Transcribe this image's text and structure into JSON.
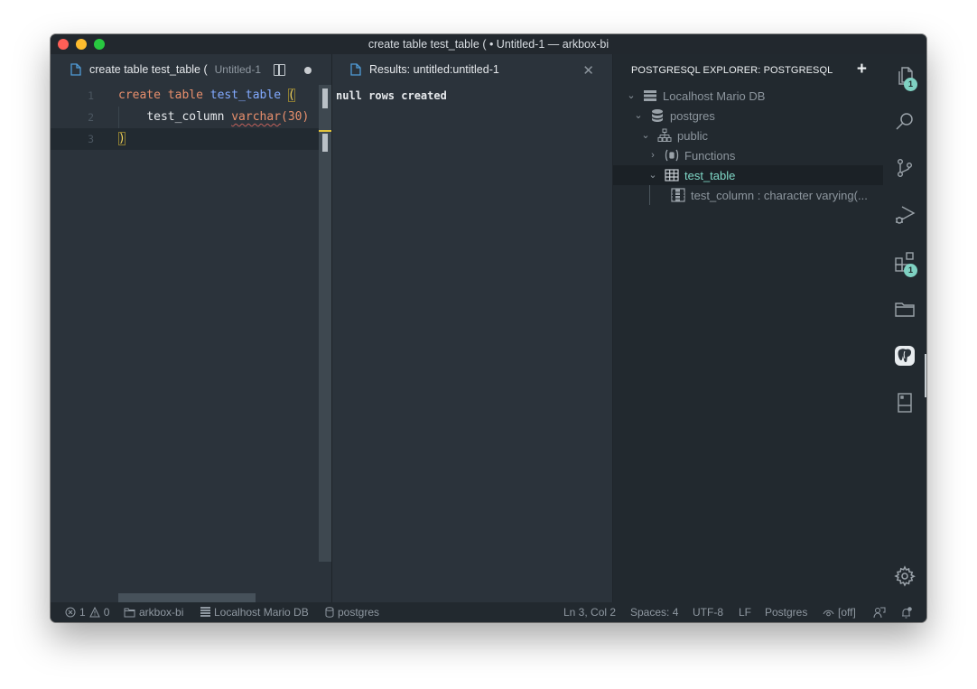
{
  "window": {
    "title": "create table test_table ( • Untitled-1 — arkbox-bi"
  },
  "editor": {
    "tab": {
      "title": "create table test_table (",
      "description": "Untitled-1"
    },
    "lines": [
      {
        "number": "1",
        "tokens": [
          [
            "kw",
            "create"
          ],
          [
            "sp",
            " "
          ],
          [
            "kw",
            "table"
          ],
          [
            "sp",
            " "
          ],
          [
            "ident",
            "test_table"
          ],
          [
            "sp",
            " "
          ],
          [
            "paren",
            "("
          ]
        ]
      },
      {
        "number": "2",
        "tokens": [
          [
            "sp",
            "    test_column "
          ],
          [
            "type",
            "varchar"
          ],
          [
            "num",
            "(30)"
          ]
        ]
      },
      {
        "number": "3",
        "tokens": [
          [
            "paren",
            ")"
          ]
        ]
      }
    ],
    "code_line1_kw1": "create",
    "code_line1_kw2": "table",
    "code_line1_ident": "test_table",
    "code_line1_paren": "(",
    "code_line2_col": "test_column",
    "code_line2_type": "varchar",
    "code_line2_args": "(30)",
    "code_line3_paren": ")"
  },
  "results": {
    "tab_title": "Results: untitled:untitled-1",
    "output": "null rows created"
  },
  "explorer": {
    "title": "POSTGRESQL EXPLORER: POSTGRESQL",
    "tree": [
      {
        "label": "Localhost Mario DB",
        "icon": "server-icon",
        "expanded": true
      },
      {
        "label": "postgres",
        "icon": "database-icon",
        "expanded": true
      },
      {
        "label": "public",
        "icon": "schema-icon",
        "expanded": true
      },
      {
        "label": "Functions",
        "icon": "function-icon",
        "expanded": false
      },
      {
        "label": "test_table",
        "icon": "table-icon",
        "expanded": true,
        "selected": true
      },
      {
        "label": "test_column : character varying(...",
        "icon": "column-icon"
      }
    ]
  },
  "activity_bar": {
    "items": [
      {
        "name": "explorer",
        "badge": "1"
      },
      {
        "name": "search"
      },
      {
        "name": "source-control"
      },
      {
        "name": "run-debug"
      },
      {
        "name": "extensions",
        "badge": "1"
      },
      {
        "name": "project-manager"
      },
      {
        "name": "postgresql",
        "active": true
      },
      {
        "name": "bookmarks"
      },
      {
        "name": "settings"
      }
    ]
  },
  "statusbar": {
    "errors": "1",
    "warnings": "0",
    "folder": "arkbox-bi",
    "connection": "Localhost Mario DB",
    "database": "postgres",
    "cursor": "Ln 3, Col 2",
    "indent": "Spaces: 4",
    "encoding": "UTF-8",
    "eol": "LF",
    "language": "Postgres",
    "watch": "[off]"
  },
  "colors": {
    "accent": "#7fd1c2",
    "keyword": "#e88f6c",
    "identifier": "#82aaff",
    "bracket": "#f5d55b"
  }
}
